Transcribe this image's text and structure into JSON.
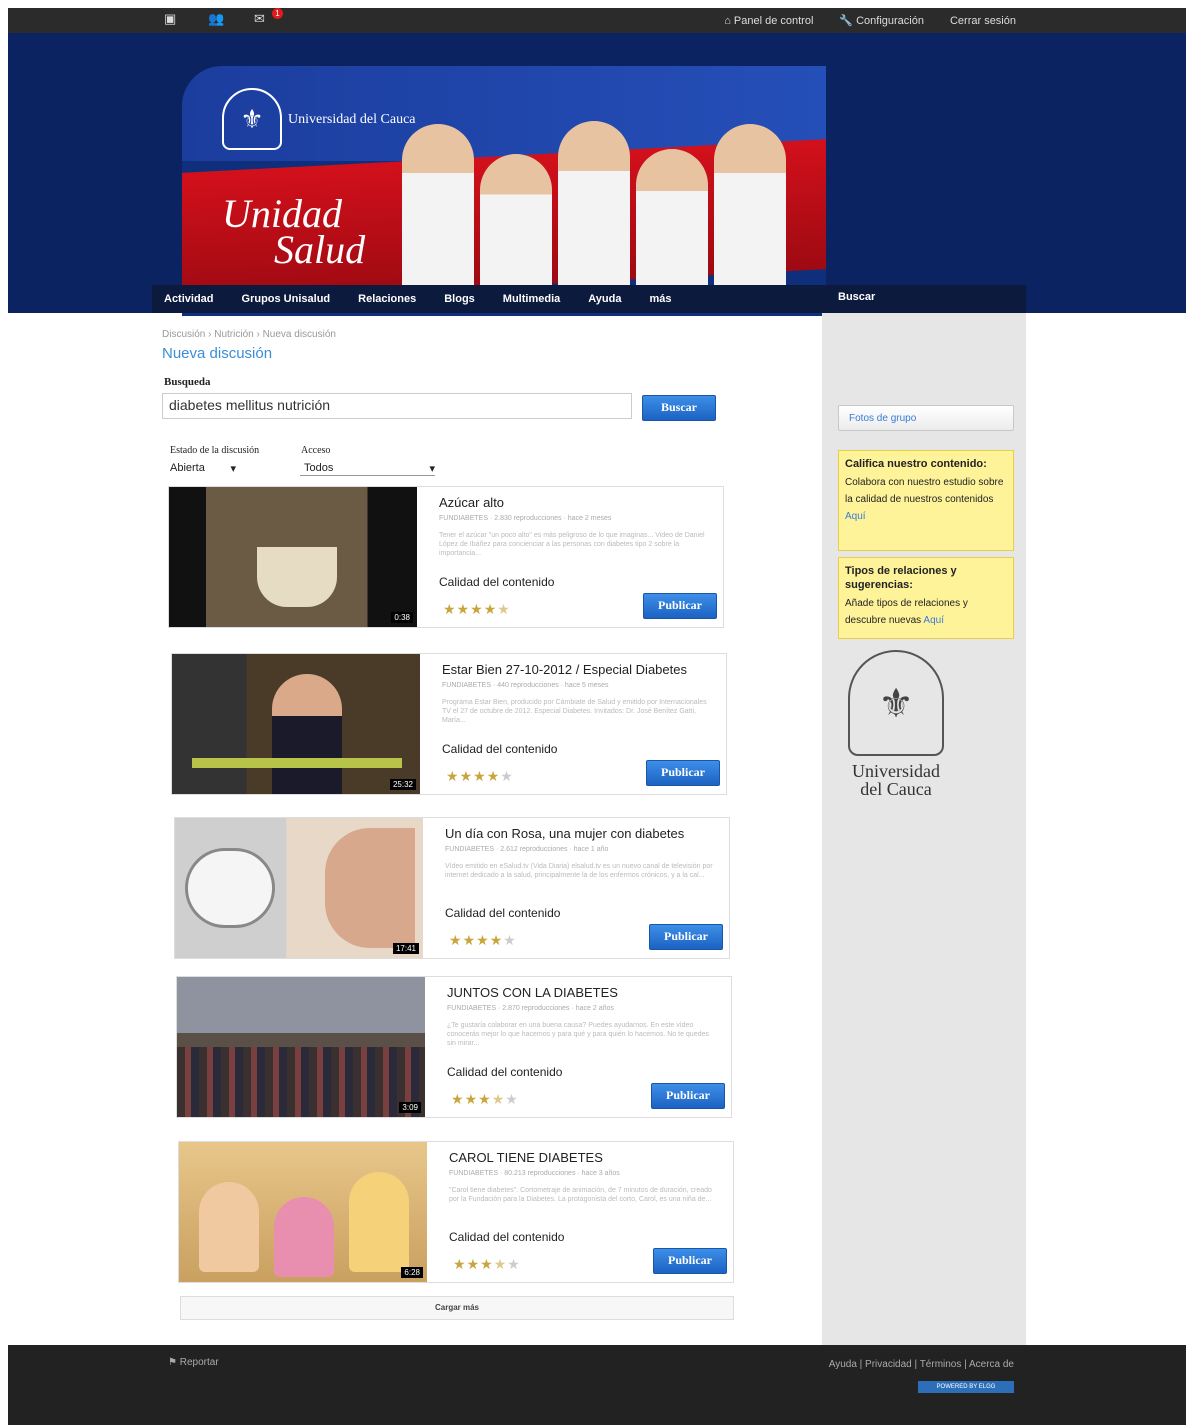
{
  "topbar": {
    "notifications_count": "1",
    "links": [
      "Panel de control",
      "Configuración",
      "Cerrar sesión"
    ]
  },
  "banner": {
    "university": "Universidad del Cauca",
    "brand_line1": "Unidad",
    "brand_line2": "Salud"
  },
  "nav": {
    "items": [
      "Actividad",
      "Grupos Unisalud",
      "Relaciones",
      "Blogs",
      "Multimedia",
      "Ayuda",
      "más"
    ],
    "search_label": "Buscar"
  },
  "breadcrumb": "Discusión › Nutrición › Nueva discusión",
  "page_title": "Nueva discusión",
  "search": {
    "label": "Busqueda",
    "value": "diabetes mellitus nutrición",
    "button": "Buscar"
  },
  "filters": {
    "state_label": "Estado de la discusión",
    "state_value": "Abierta",
    "access_label": "Acceso",
    "access_value": "Todos"
  },
  "videos": [
    {
      "title": "Azúcar alto",
      "meta": "FUNDIABETES · 2.830 reproducciones · hace 2 meses",
      "desc": "Tener el azúcar \"un poco alto\" es más peligroso de lo que imaginas... Video de Daniel López de Ibáñez para concienciar a las personas con diabetes tipo 2 sobre la importancia...",
      "quality": "Calidad del contenido",
      "rating": 4.5,
      "duration": "0:38",
      "button": "Publicar"
    },
    {
      "title": "Estar Bien 27-10-2012 / Especial Diabetes",
      "meta": "FUNDIABETES · 440 reproducciones · hace 5 meses",
      "desc": "Programa Estar Bien, producido por Cámbiate de Salud y emitido por Internacionales TV el 27 de octubre de 2012. Especial Diabetes. Invitados: Dr. José Benítez Gatti, María...",
      "quality": "Calidad del contenido",
      "rating": 4,
      "duration": "25:32",
      "button": "Publicar"
    },
    {
      "title": "Un día con Rosa, una mujer con diabetes",
      "meta": "FUNDIABETES · 2.612 reproducciones · hace 1 año",
      "desc": "Vídeo emitido en eSalud.tv (Vida Diaria) elsalud.tv es un nuevo canal de televisión por internet dedicado a la salud, principalmente la de los enfermos crónicos, y a la cal...",
      "quality": "Calidad del contenido",
      "rating": 4,
      "duration": "17:41",
      "button": "Publicar"
    },
    {
      "title": "JUNTOS CON LA DIABETES",
      "meta": "FUNDIABETES · 2.870 reproducciones · hace 2 años",
      "desc": "¿Te gustaría colaborar en una buena causa? Puedes ayudarnos. En este vídeo conocerás mejor lo que hacemos y para qué y para quién lo hacemos. No te quedes sin mirar...",
      "quality": "Calidad del contenido",
      "rating": 3.5,
      "duration": "3:09",
      "button": "Publicar"
    },
    {
      "title": "CAROL TIENE DIABETES",
      "meta": "FUNDIABETES · 80.213 reproducciones · hace 3 años",
      "desc": "\"Carol tiene diabetes\". Cortometraje de animación, de 7 minutos de duración, creado por la Fundación para la Diabetes. La protagonista del corto, Carol, es una niña de...",
      "quality": "Calidad del contenido",
      "rating": 3.5,
      "duration": "6:28",
      "button": "Publicar"
    }
  ],
  "load_more": "Cargar más",
  "sidebar": {
    "group_photos": "Fotos de grupo",
    "note1": {
      "title": "Califica nuestro contenido:",
      "text": "Colabora con nuestro estudio sobre la calidad de nuestros contenidos",
      "link": "Aquí"
    },
    "note2": {
      "title": "Tipos de relaciones y sugerencias:",
      "text": "Añade tipos de relaciones y descubre nuevas",
      "link": "Aquí"
    },
    "logo_text1": "Universidad",
    "logo_text2": "del Cauca"
  },
  "footer": {
    "report": "Reportar",
    "links": "Ayuda | Privacidad | Términos | Acerca de",
    "powered": "POWERED BY ELGG"
  }
}
